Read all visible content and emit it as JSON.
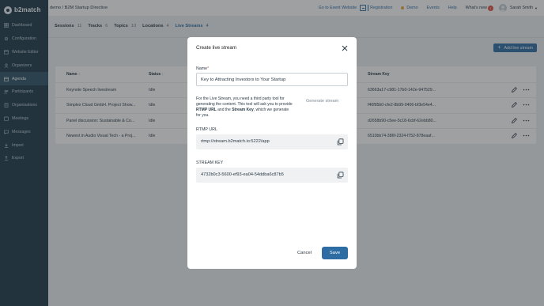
{
  "app": {
    "logo_text": "b2match"
  },
  "sidebar": {
    "items": [
      {
        "label": "Dashboard",
        "icon": "dashboard-icon"
      },
      {
        "label": "Configuration",
        "icon": "configuration-icon"
      },
      {
        "label": "Website Editor",
        "icon": "website-editor-icon"
      },
      {
        "label": "Organizers",
        "icon": "organizers-icon"
      },
      {
        "label": "Agenda",
        "icon": "agenda-icon",
        "active": true
      },
      {
        "label": "Participants",
        "icon": "participants-icon"
      },
      {
        "label": "Organisations",
        "icon": "organisations-icon"
      },
      {
        "label": "Meetings",
        "icon": "meetings-icon"
      },
      {
        "label": "Messages",
        "icon": "messages-icon"
      },
      {
        "label": "Import",
        "icon": "import-icon"
      },
      {
        "label": "Export",
        "icon": "export-icon"
      }
    ]
  },
  "header": {
    "breadcrumb": "demo / B2M Startup Directive",
    "go_to_event": "Go to Event Website",
    "registration": "Registration",
    "demo": "Demo",
    "events": "Events",
    "help": "Help",
    "whats_new": "What's new",
    "whats_new_count": "1",
    "user_name": "Sarah Smith"
  },
  "tabs": [
    {
      "label": "Sessions",
      "count": "11"
    },
    {
      "label": "Tracks",
      "count": "6"
    },
    {
      "label": "Topics",
      "count": "10"
    },
    {
      "label": "Locations",
      "count": "4"
    },
    {
      "label": "Live Streams",
      "count": "4",
      "active": true
    }
  ],
  "add_button": "Add live stream",
  "table": {
    "headers": {
      "name": "Name",
      "status": "Status",
      "stream_key": "Stream Key"
    },
    "rows": [
      {
        "name": "Keynote Speech livestream",
        "status": "Idle",
        "stream_key": "63663a17-c981-17b0-142e-947529..."
      },
      {
        "name": "Simplex Cloud GmbH. Project Show...",
        "status": "Idle",
        "stream_key": "f40f95b0-cfe2-8b99-0406-bf3e54e4..."
      },
      {
        "name": "Panel discussion: Sustainable & Co...",
        "status": "Idle",
        "stream_key": "d2658b90-c5ee-5c18-6cbf-62ebb80..."
      },
      {
        "name": "Newest in Audio Visual Tech - a Proj...",
        "status": "Idle",
        "stream_key": "6510bb74-386f-2324-f752-878eaaf..."
      }
    ]
  },
  "modal": {
    "title": "Create live stream",
    "name_label": "Name",
    "name_required": "*",
    "name_value": "Key to Attracting Investors to Your Startup",
    "help_part1": "For the Live Stream, you need a third party tool for generating the content. This tool will ask you to provide ",
    "help_rtmp": "RTMP URL",
    "help_and": " and the ",
    "help_key": "Stream Key",
    "help_part2": ", which we generate for you.",
    "generate_button": "Generate stream",
    "rtmp_label": "RTMP URL",
    "rtmp_value": "rtmp://stream.b2match.io:5222/app",
    "key_label": "STREAM KEY",
    "key_value": "4732b0c3-5600-ef93-ea04-54ddba6c87b5",
    "cancel": "Cancel",
    "save": "Save"
  },
  "colors": {
    "sidebar_bg": "#1f3a4a",
    "accent": "#2e6da4",
    "demo_dot": "#f0a83a",
    "badge": "#e04f3c"
  }
}
